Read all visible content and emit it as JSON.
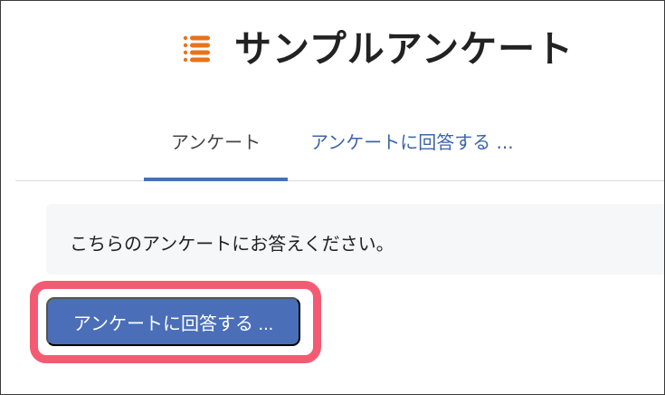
{
  "header": {
    "title": "サンプルアンケート",
    "logo_icon": "list-icon",
    "logo_color": "#e8731a"
  },
  "tabs": [
    {
      "label": "アンケート",
      "active": true
    },
    {
      "label": "アンケートに回答する ...",
      "active": false
    }
  ],
  "notice": {
    "text": "こちらのアンケートにお答えください。"
  },
  "cta": {
    "label": "アンケートに回答する ...",
    "color": "#4a6fb8",
    "highlight_color": "#f35b73"
  }
}
